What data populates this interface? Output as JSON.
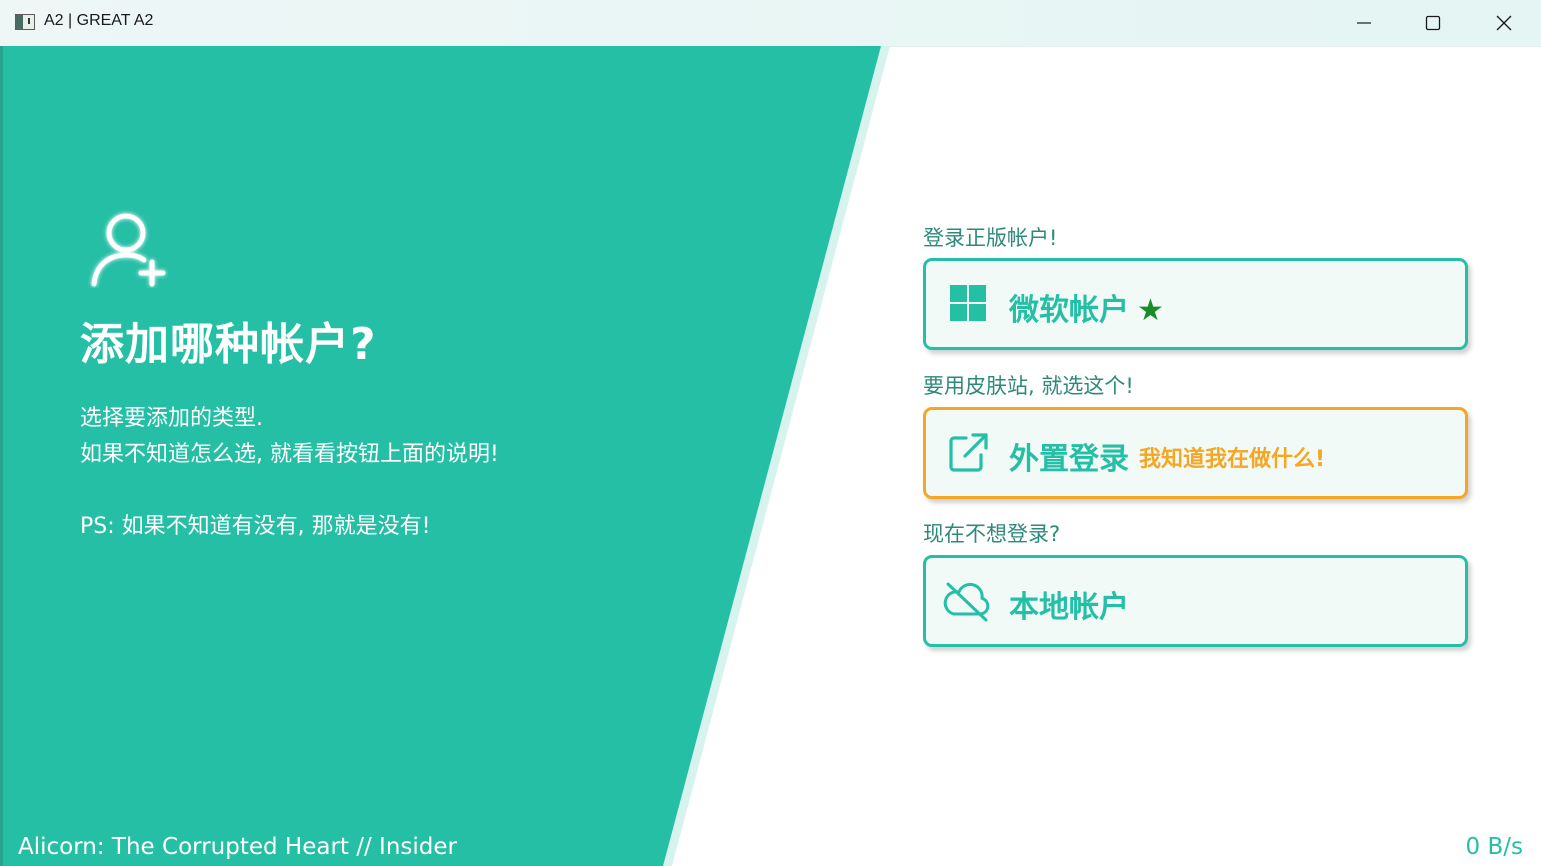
{
  "window": {
    "title": "A2 | GREAT A2"
  },
  "left_panel": {
    "heading": "添加哪种帐户?",
    "description_lines": [
      "选择要添加的类型.",
      "如果不知道怎么选, 就看看按钮上面的说明!",
      "PS: 如果不知道有没有, 那就是没有!"
    ],
    "icon": "user-add-icon"
  },
  "options": [
    {
      "caption": "登录正版帐户!",
      "label": "微软帐户",
      "badge": "★",
      "icon": "windows-logo-icon"
    },
    {
      "caption": "要用皮肤站, 就选这个!",
      "label": "外置登录",
      "hint": "我知道我在做什么!",
      "icon": "external-link-icon"
    },
    {
      "caption": "现在不想登录?",
      "label": "本地帐户",
      "icon": "cloud-off-icon"
    }
  ],
  "footer": {
    "app_info": "Alicorn: The Corrupted Heart // Insider",
    "speed": "0 B/s"
  },
  "colors": {
    "accent": "#25bfa6",
    "warning": "#f5a623",
    "star": "#1a8a2a",
    "panel_text": "#ffffff"
  }
}
